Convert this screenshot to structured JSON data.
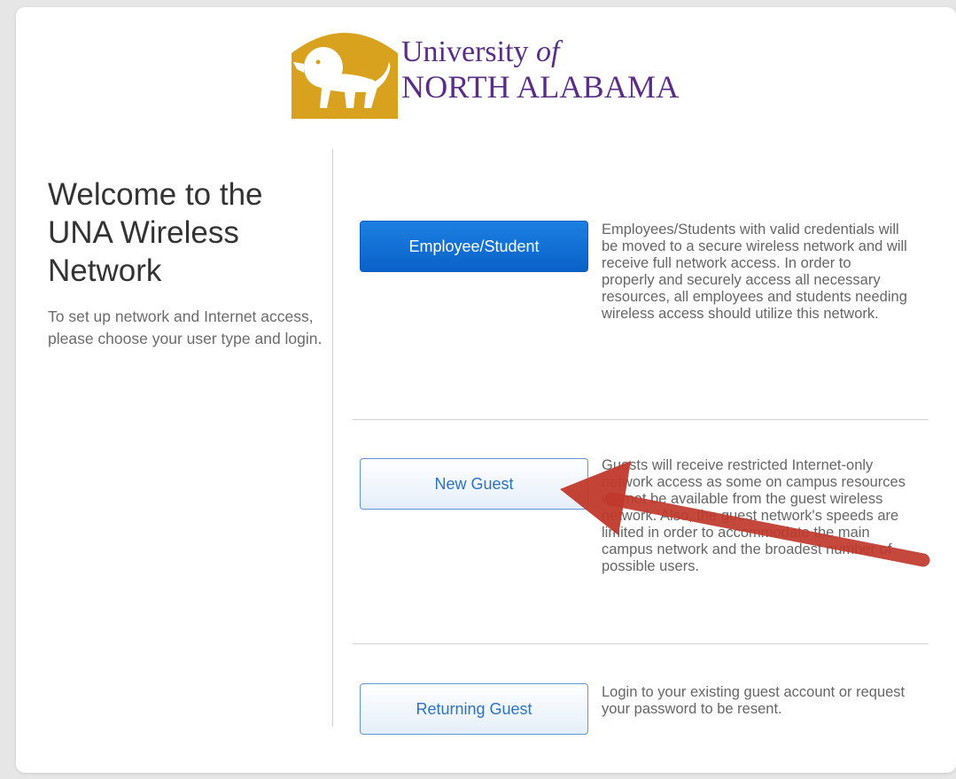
{
  "logo": {
    "line1_prefix": "University ",
    "line1_of": "of",
    "line2": "NORTH ALABAMA"
  },
  "left": {
    "heading": "Welcome to the UNA Wireless Network",
    "intro": "To set up network and Internet access, please choose your user type and login."
  },
  "options": [
    {
      "button_label": "Employee/Student",
      "description": "Employees/Students with valid credentials will be moved to a secure wireless network and will receive full network access. In order to properly and securely access all necessary resources, all employees and students needing wireless access should utilize this network."
    },
    {
      "button_label": "New Guest",
      "description": "Guests will receive restricted Internet-only network access as some on campus resources will not be available from the guest wireless network. Also, the guest network's speeds are limited in order to accommodate the main campus network and the broadest number of possible users."
    },
    {
      "button_label": "Returning Guest",
      "description": "Login to your existing guest account or request your password to be resent."
    }
  ],
  "colors": {
    "brand_gold": "#d8a21e",
    "brand_purple": "#5b2d86",
    "primary_button": "#0a62c8",
    "annotation_arrow": "#c0392b"
  },
  "icons": {
    "mascot": "lion-icon",
    "annotation": "red-arrow-icon"
  }
}
